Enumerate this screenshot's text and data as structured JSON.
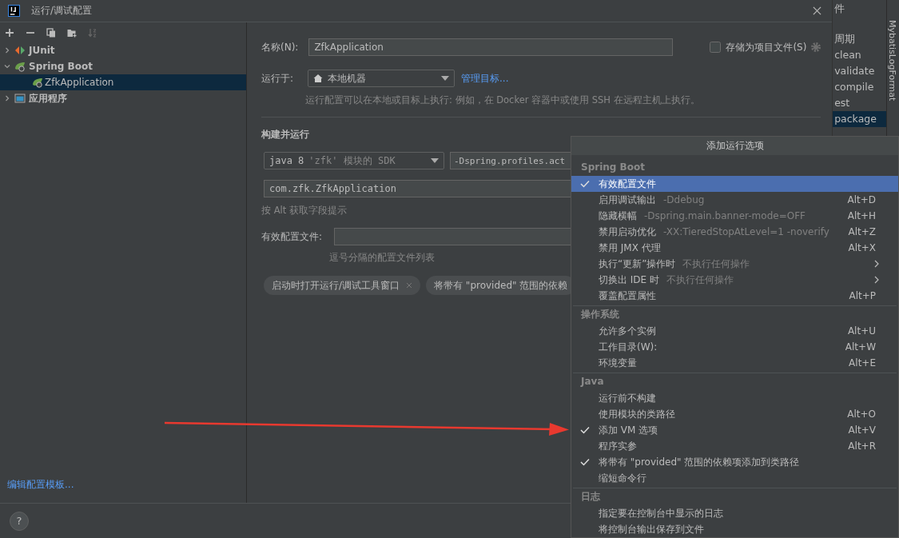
{
  "window": {
    "title": "运行/调试配置"
  },
  "tree": [
    {
      "label": "JUnit",
      "expanded": false,
      "selected": false
    },
    {
      "label": "Spring Boot",
      "expanded": true,
      "selected": false,
      "children": [
        {
          "label": "ZfkApplication",
          "selected": true
        }
      ]
    },
    {
      "label": "应用程序",
      "expanded": false,
      "selected": false
    }
  ],
  "edit_templates_link": "编辑配置模板...",
  "name": {
    "label": "名称(N):",
    "value": "ZfkApplication"
  },
  "store_as_project_file": {
    "label": "存储为项目文件(S)",
    "checked": false
  },
  "run_on": {
    "label": "运行于:",
    "value": "本地机器",
    "link": "管理目标...",
    "hint": "运行配置可以在本地或目标上执行: 例如，在 Docker 容器中或使用 SSH 在远程主机上执行。"
  },
  "build_section": {
    "title": "构建并运行",
    "sdk": {
      "prefix": "java 8",
      "module": "'zfk' 模块的 SDK"
    },
    "vm_options": "-Dspring.profiles.act",
    "main_class": "com.zfk.ZfkApplication",
    "hint": "按 Alt 获取字段提示"
  },
  "profiles": {
    "label": "有效配置文件:",
    "hint": "逗号分隔的配置文件列表"
  },
  "chips": [
    "启动时打开运行/调试工具窗口",
    "将带有 \"provided\" 范围的依赖"
  ],
  "maven_panel": {
    "items": [
      {
        "label": "件",
        "selected": false
      },
      {
        "label": "周期",
        "selected": false
      },
      {
        "label": "clean",
        "selected": false
      },
      {
        "label": "validate",
        "selected": false
      },
      {
        "label": "compile",
        "selected": false
      },
      {
        "label": "est",
        "selected": false
      },
      {
        "label": "package",
        "selected": true
      }
    ]
  },
  "side_strip": {
    "label": "MybatisLogFormat"
  },
  "menu": {
    "title": "添加运行选项",
    "sections": [
      {
        "title": "Spring Boot",
        "items": [
          {
            "label": "有效配置文件",
            "checked": true,
            "selected": true,
            "submenu": false
          },
          {
            "label": "启用调试输出",
            "hint": "-Ddebug",
            "shortcut": "Alt+D",
            "checked": false,
            "selected": false,
            "submenu": false
          },
          {
            "label": "隐藏横幅",
            "hint": "-Dspring.main.banner-mode=OFF",
            "shortcut": "Alt+H",
            "checked": false,
            "selected": false,
            "submenu": false
          },
          {
            "label": "禁用启动优化",
            "hint": "-XX:TieredStopAtLevel=1 -noverify",
            "shortcut": "Alt+Z",
            "checked": false,
            "selected": false,
            "submenu": false
          },
          {
            "label": "禁用 JMX 代理",
            "shortcut": "Alt+X",
            "checked": false,
            "selected": false,
            "submenu": false
          },
          {
            "label": "执行“更新”操作时",
            "hint": "不执行任何操作",
            "checked": false,
            "selected": false,
            "submenu": true
          },
          {
            "label": "切换出 IDE 时",
            "hint": "不执行任何操作",
            "checked": false,
            "selected": false,
            "submenu": true
          },
          {
            "label": "覆盖配置属性",
            "shortcut": "Alt+P",
            "checked": false,
            "selected": false,
            "submenu": false
          }
        ]
      },
      {
        "title": "操作系统",
        "items": [
          {
            "label": "允许多个实例",
            "shortcut": "Alt+U",
            "checked": false,
            "selected": false,
            "submenu": false
          },
          {
            "label": "工作目录(W):",
            "shortcut": "Alt+W",
            "checked": false,
            "selected": false,
            "submenu": false
          },
          {
            "label": "环境变量",
            "shortcut": "Alt+E",
            "checked": false,
            "selected": false,
            "submenu": false
          }
        ]
      },
      {
        "title": "Java",
        "items": [
          {
            "label": "运行前不构建",
            "checked": false,
            "selected": false,
            "submenu": false
          },
          {
            "label": "使用模块的类路径",
            "shortcut": "Alt+O",
            "checked": false,
            "selected": false,
            "submenu": false
          },
          {
            "label": "添加 VM 选项",
            "shortcut": "Alt+V",
            "checked": true,
            "selected": false,
            "submenu": false
          },
          {
            "label": "程序实参",
            "shortcut": "Alt+R",
            "checked": false,
            "selected": false,
            "submenu": false
          },
          {
            "label": "将带有 \"provided\" 范围的依赖项添加到类路径",
            "checked": true,
            "selected": false,
            "submenu": false
          },
          {
            "label": "缩短命令行",
            "checked": false,
            "selected": false,
            "submenu": false
          }
        ]
      },
      {
        "title": "日志",
        "items": [
          {
            "label": "指定要在控制台中显示的日志",
            "checked": false,
            "selected": false,
            "submenu": false
          },
          {
            "label": "将控制台输出保存到文件",
            "checked": false,
            "selected": false,
            "submenu": false
          }
        ]
      }
    ]
  },
  "help_button": "?"
}
